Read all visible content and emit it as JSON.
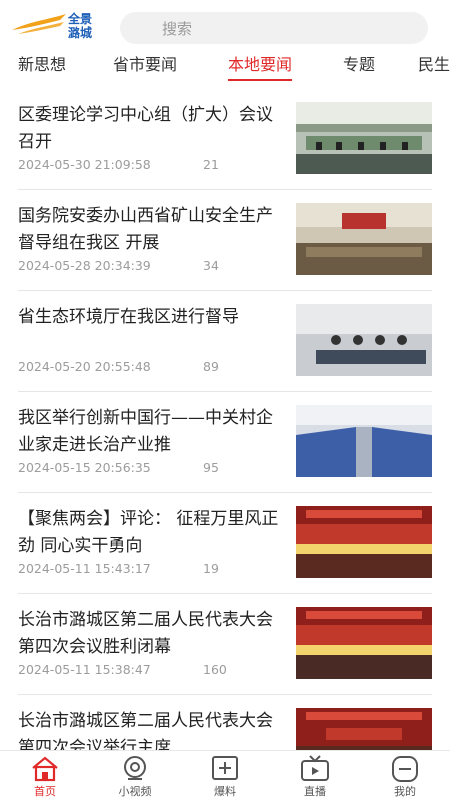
{
  "brand": {
    "logo_text_top": "全景",
    "logo_text_bottom": "潞城",
    "accent": "#e02a2a",
    "logo_gold": "#f2a21a",
    "logo_blue": "#1d5fb8"
  },
  "search": {
    "placeholder": "搜索",
    "icon": "search-icon"
  },
  "tabs": [
    {
      "label": "新思想"
    },
    {
      "label": "省市要闻"
    },
    {
      "label": "本地要闻",
      "active": true
    },
    {
      "label": "专题"
    },
    {
      "label": "民生"
    }
  ],
  "news": [
    {
      "title": "区委理论学习中心组（扩大）会议召开",
      "date": "2024-05-30 21:09:58",
      "views": "21"
    },
    {
      "title": "国务院安委办山西省矿山安全生产督导组在我区 开展",
      "date": "2024-05-28 20:34:39",
      "views": "34"
    },
    {
      "title": "省生态环境厅在我区进行督导",
      "date": "2024-05-20 20:55:48",
      "views": "89"
    },
    {
      "title": "我区举行创新中国行——中关村企业家走进长治产业推",
      "date": "2024-05-15 20:56:35",
      "views": "95"
    },
    {
      "title": "【聚焦两会】评论：  征程万里风正劲 同心实干勇向",
      "date": "2024-05-11 15:43:17",
      "views": "19"
    },
    {
      "title": "长治市潞城区第二届人民代表大会第四次会议胜利闭幕",
      "date": "2024-05-11 15:38:47",
      "views": "160"
    },
    {
      "title": "长治市潞城区第二届人民代表大会第四次会议举行主席",
      "date": "",
      "views": ""
    }
  ],
  "bottom_nav": [
    {
      "label": "首页",
      "icon": "home-icon",
      "active": true
    },
    {
      "label": "小视频",
      "icon": "video-icon"
    },
    {
      "label": "爆料",
      "icon": "plus-box-icon"
    },
    {
      "label": "直播",
      "icon": "tv-icon"
    },
    {
      "label": "我的",
      "icon": "profile-icon"
    }
  ]
}
